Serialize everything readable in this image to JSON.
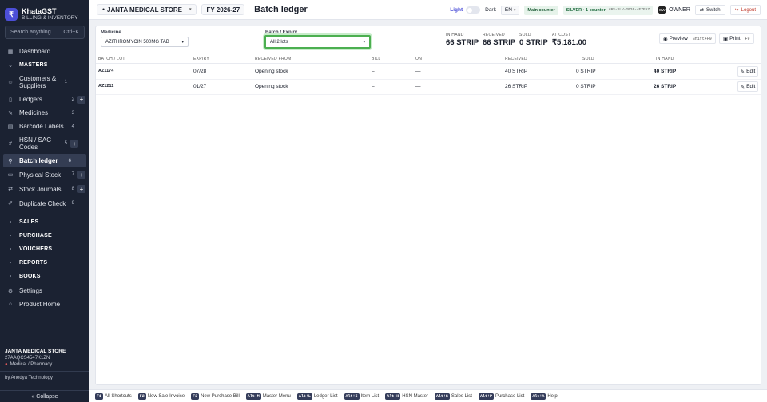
{
  "sidebar": {
    "brand_name": "KhataGST",
    "brand_sub": "BILLING & INVENTORY",
    "logo_glyph": "₹",
    "search_placeholder": "Search anything",
    "search_shortcut": "Ctrl+K",
    "items": [
      {
        "label": "Dashboard",
        "icon": "grid-icon",
        "glyph": "▦",
        "count": "",
        "plus": false
      },
      {
        "label": "MASTERS",
        "icon": "chevron-down-icon",
        "glyph": "⌄",
        "count": "",
        "plus": false,
        "section": true
      },
      {
        "label": "Customers & Suppliers",
        "icon": "users-icon",
        "glyph": "☺",
        "count": "1",
        "plus": false
      },
      {
        "label": "Ledgers",
        "icon": "book-icon",
        "glyph": "▯",
        "count": "2",
        "plus": true
      },
      {
        "label": "Medicines",
        "icon": "pill-icon",
        "glyph": "✎",
        "count": "3",
        "plus": false
      },
      {
        "label": "Barcode Labels",
        "icon": "barcode-icon",
        "glyph": "▤",
        "count": "4",
        "plus": false
      },
      {
        "label": "HSN / SAC Codes",
        "icon": "hash-icon",
        "glyph": "#",
        "count": "5",
        "plus": true
      },
      {
        "label": "Batch ledger",
        "icon": "search-icon",
        "glyph": "⚲",
        "count": "6",
        "plus": false,
        "active": true
      },
      {
        "label": "Physical Stock",
        "icon": "clipboard-icon",
        "glyph": "▭",
        "count": "7",
        "plus": true
      },
      {
        "label": "Stock Journals",
        "icon": "swap-icon",
        "glyph": "⇄",
        "count": "8",
        "plus": true
      },
      {
        "label": "Duplicate Check",
        "icon": "pen-icon",
        "glyph": "✐",
        "count": "9",
        "plus": false
      },
      {
        "label": "SALES",
        "icon": "chevron-right-icon",
        "glyph": "›",
        "count": "",
        "plus": false,
        "section": true
      },
      {
        "label": "PURCHASE",
        "icon": "chevron-right-icon",
        "glyph": "›",
        "count": "",
        "plus": false,
        "section": true
      },
      {
        "label": "VOUCHERS",
        "icon": "chevron-right-icon",
        "glyph": "›",
        "count": "",
        "plus": false,
        "section": true
      },
      {
        "label": "REPORTS",
        "icon": "chevron-right-icon",
        "glyph": "›",
        "count": "",
        "plus": false,
        "section": true
      },
      {
        "label": "BOOKS",
        "icon": "chevron-right-icon",
        "glyph": "›",
        "count": "",
        "plus": false,
        "section": true
      },
      {
        "label": "Settings",
        "icon": "gear-icon",
        "glyph": "⚙",
        "count": "",
        "plus": false
      },
      {
        "label": "Product Home",
        "icon": "home-icon",
        "glyph": "⌂",
        "count": "",
        "plus": false
      }
    ],
    "footer_store": "JANTA MEDICAL STORE",
    "footer_gstin": "27AAQCS4547K1ZN",
    "footer_category": "Medical / Pharmacy",
    "footer_credit": "by Anedya Technology",
    "collapse_label": "« Collapse"
  },
  "topbar": {
    "store_name": "JANTA MEDICAL STORE",
    "fy_label": "FY 2026-27",
    "page_title": "Batch ledger",
    "theme_light": "Light",
    "theme_dark": "Dark",
    "language": "EN",
    "counter_label": "Main counter",
    "license_label": "SILVER · 1 counter",
    "license_code": "ANS-SLV-2026-4E7F57",
    "user_initials": "OW",
    "user_role": "OWNER",
    "switch_label": "Switch",
    "logout_label": "Logout",
    "accent": "#4c4fd8",
    "logout_color": "#c0392b"
  },
  "filters": {
    "medicine_label": "Medicine",
    "medicine_value": "AZITHROMYCIN 500MG TAB",
    "batch_label": "Batch / Expiry",
    "batch_value": "All 2 lots",
    "focus_color": "#4caf50"
  },
  "stats": [
    {
      "label": "IN HAND",
      "value": "66 STRIP"
    },
    {
      "label": "RECEIVED",
      "value": "66 STRIP"
    },
    {
      "label": "SOLD",
      "value": "0 STRIP"
    },
    {
      "label": "AT COST",
      "value": "₹5,181.00"
    }
  ],
  "actions": {
    "preview_label": "Preview",
    "preview_key": "Shift+F9",
    "print_label": "Print",
    "print_key": "F9"
  },
  "table": {
    "headers": [
      "BATCH / LOT",
      "EXPIRY",
      "RECEIVED FROM",
      "BILL",
      "ON",
      "RECEIVED",
      "SOLD",
      "IN HAND"
    ],
    "rows": [
      {
        "batch": "AZ1174",
        "expiry": "07/28",
        "from": "Opening stock",
        "bill": "–",
        "on": "—",
        "received": "40 STRIP",
        "sold": "0 STRIP",
        "in_hand": "40 STRIP",
        "edit": "Edit"
      },
      {
        "batch": "AZ1211",
        "expiry": "01/27",
        "from": "Opening stock",
        "bill": "–",
        "on": "—",
        "received": "26 STRIP",
        "sold": "0 STRIP",
        "in_hand": "26 STRIP",
        "edit": "Edit"
      }
    ]
  },
  "shortcuts": [
    {
      "key": "F1",
      "label": "All Shortcuts"
    },
    {
      "key": "F2",
      "label": "New Sale Invoice"
    },
    {
      "key": "F3",
      "label": "New Purchase Bill"
    },
    {
      "key": "Alt+M",
      "label": "Master Menu"
    },
    {
      "key": "Alt+L",
      "label": "Ledger List"
    },
    {
      "key": "Alt+I",
      "label": "Item List"
    },
    {
      "key": "Alt+H",
      "label": "HSN Master"
    },
    {
      "key": "Alt+S",
      "label": "Sales List"
    },
    {
      "key": "Alt+P",
      "label": "Purchase List"
    },
    {
      "key": "Alt+A",
      "label": "Help"
    }
  ]
}
